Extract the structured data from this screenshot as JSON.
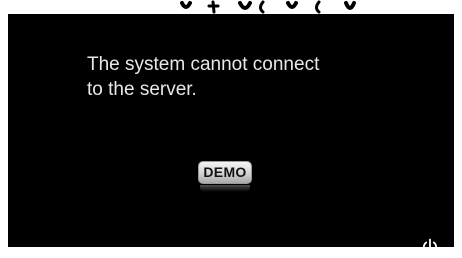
{
  "message": {
    "line1": "The system cannot connect",
    "line2": "to the server."
  },
  "demo_button": {
    "label": "DEMO"
  },
  "power_button": {
    "icon": "power-icon"
  },
  "colors": {
    "background": "#000000",
    "text": "#e8e8e8",
    "button_top": "#f4f4f4",
    "button_bottom": "#a9a9a9"
  }
}
